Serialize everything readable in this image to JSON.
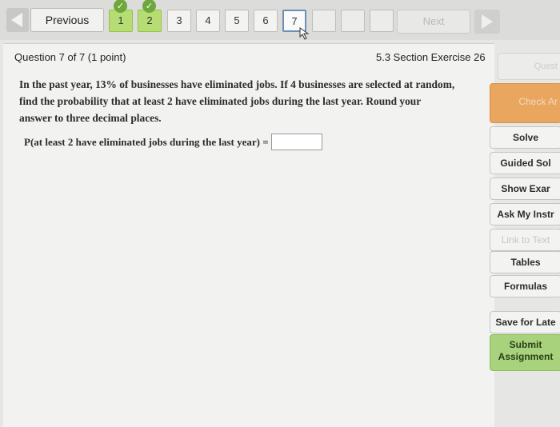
{
  "nav": {
    "previous_label": "Previous",
    "next_label": "Next",
    "questions": [
      {
        "num": "1",
        "status": "done"
      },
      {
        "num": "2",
        "status": "done"
      },
      {
        "num": "3",
        "status": "open"
      },
      {
        "num": "4",
        "status": "open"
      },
      {
        "num": "5",
        "status": "open"
      },
      {
        "num": "6",
        "status": "open"
      },
      {
        "num": "7",
        "status": "current"
      }
    ]
  },
  "question": {
    "header": "Question 7 of 7 (1 point)",
    "section": "5.3 Section Exercise 26",
    "text_line1": "In the past year, 13% of businesses have eliminated jobs. If 4 businesses are selected at random,",
    "text_line2": "find the probability that at least 2 have eliminated jobs during the last year. Round your",
    "text_line3": "answer to three decimal places.",
    "answer_label": "P(at least 2 have eliminated jobs during the last year) =",
    "answer_value": ""
  },
  "sidebar": {
    "question_help": "Quest",
    "check_answer": "Check Ar",
    "solve": "Solve",
    "guided_solution": "Guided Sol",
    "show_example": "Show Exar",
    "ask_instructor": "Ask My Instr",
    "link_to_text": "Link to Text",
    "tables": "Tables",
    "formulas": "Formulas",
    "save_for_later": "Save for Late",
    "submit_line1": "Submit",
    "submit_line2": "Assignment"
  },
  "colors": {
    "done_green": "#b6dd74",
    "check_orange": "#e9a65f",
    "submit_green": "#a8d27b"
  }
}
